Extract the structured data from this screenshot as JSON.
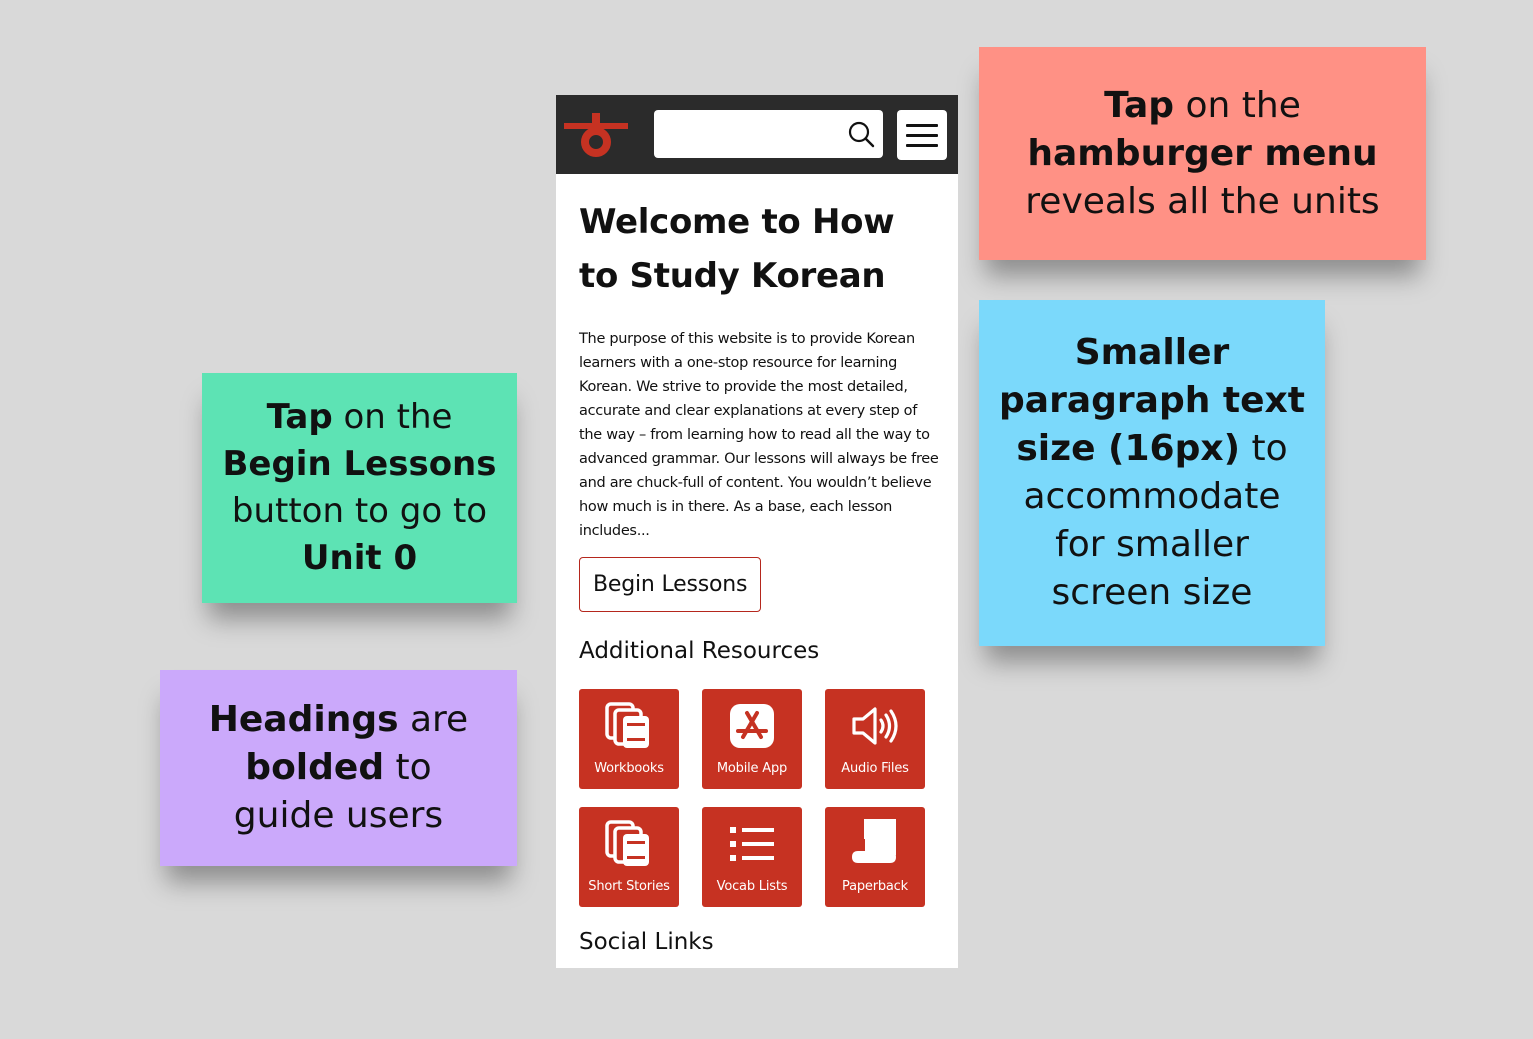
{
  "notes": {
    "menu": {
      "line1_bold": "Tap",
      "line1_rest": " on the",
      "line2_bold": "hamburger menu",
      "line3": "reveals all the units"
    },
    "text_size": {
      "line1_bold": "Smaller",
      "line2_bold": "paragraph text",
      "line3_bold": "size (16px)",
      "line3_rest": " to",
      "line4": "accommodate",
      "line5": "for smaller",
      "line6": "screen size"
    },
    "begin": {
      "line1_bold": "Tap",
      "line1_rest": " on the",
      "line2_bold": "Begin Lessons",
      "line3": "button to go to",
      "line4_bold": "Unit 0"
    },
    "headings": {
      "line1_bold": "Headings",
      "line1_rest": " are",
      "line2_bold": "bolded",
      "line2_rest": " to",
      "line3": "guide users"
    }
  },
  "header": {
    "search_value": ""
  },
  "main": {
    "title": "Welcome to How to Study Korean",
    "paragraph": "The purpose of this website is to provide Korean learners with a one-stop resource for learning Korean. We strive to provide the most detailed, accurate and clear explanations at every step of the way – from learning how to read all the way to advanced grammar. Our lessons will always be free and are chuck-full of content. You wouldn’t believe how much is in there. As a base, each lesson includes...",
    "begin_button": "Begin Lessons",
    "resources_heading": "Additional Resources",
    "resources": [
      {
        "label": "Workbooks",
        "icon": "books-icon"
      },
      {
        "label": "Mobile App",
        "icon": "app-store-icon"
      },
      {
        "label": "Audio Files",
        "icon": "speaker-icon"
      },
      {
        "label": "Short Stories",
        "icon": "books-icon"
      },
      {
        "label": "Vocab Lists",
        "icon": "list-icon"
      },
      {
        "label": "Paperback",
        "icon": "paper-scroll-icon"
      }
    ],
    "social_heading": "Social Links"
  },
  "colors": {
    "brand_red": "#c63222",
    "topbar": "#2b2b2b",
    "background": "#d9d9d9"
  }
}
